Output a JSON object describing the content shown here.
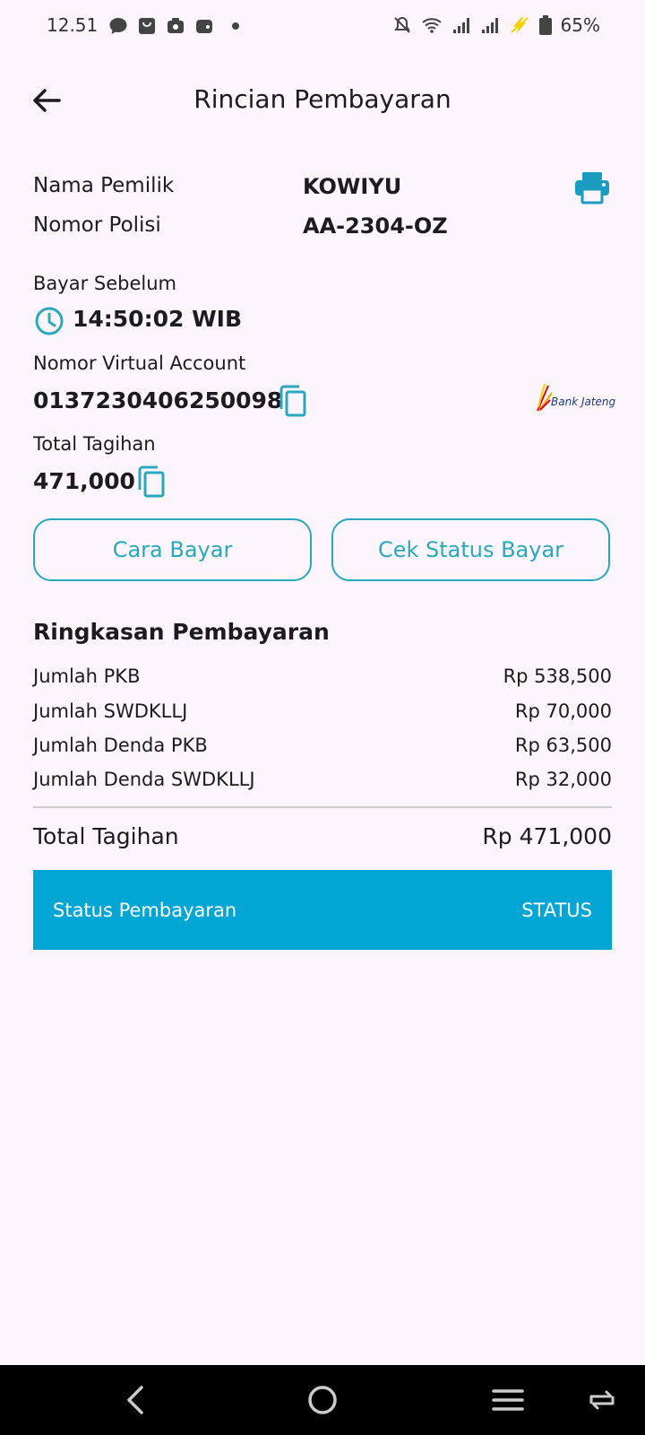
{
  "status_bar": {
    "time": "12.51",
    "battery": "65%"
  },
  "appbar": {
    "title": "Rincian Pembayaran"
  },
  "owner": {
    "name_label": "Nama Pemilik",
    "name_value": "KOWIYU",
    "plate_label": "Nomor Polisi",
    "plate_value": "AA-2304-OZ"
  },
  "deadline": {
    "label": "Bayar Sebelum",
    "value": "14:50:02 WIB"
  },
  "virtual_account": {
    "label": "Nomor Virtual Account",
    "value": "0137230406250098",
    "bank": "Bank Jateng"
  },
  "bill": {
    "label": "Total Tagihan",
    "value": "471,000"
  },
  "buttons": {
    "how_to_pay": "Cara Bayar",
    "check_status": "Cek Status Bayar"
  },
  "summary": {
    "title": "Ringkasan Pembayaran",
    "items": [
      {
        "label": "Jumlah PKB",
        "amount": "Rp 538,500"
      },
      {
        "label": "Jumlah SWDKLLJ",
        "amount": "Rp 70,000"
      },
      {
        "label": "Jumlah Denda PKB",
        "amount": "Rp 63,500"
      },
      {
        "label": "Jumlah Denda SWDKLLJ",
        "amount": "Rp 32,000"
      }
    ],
    "total_label": "Total Tagihan",
    "total_amount": "Rp 471,000"
  },
  "payment_status": {
    "label": "Status Pembayaran",
    "value": "STATUS"
  },
  "colors": {
    "accent": "#2aa8bd",
    "status_bg": "#02a6d4",
    "background": "#fcf6fc"
  }
}
